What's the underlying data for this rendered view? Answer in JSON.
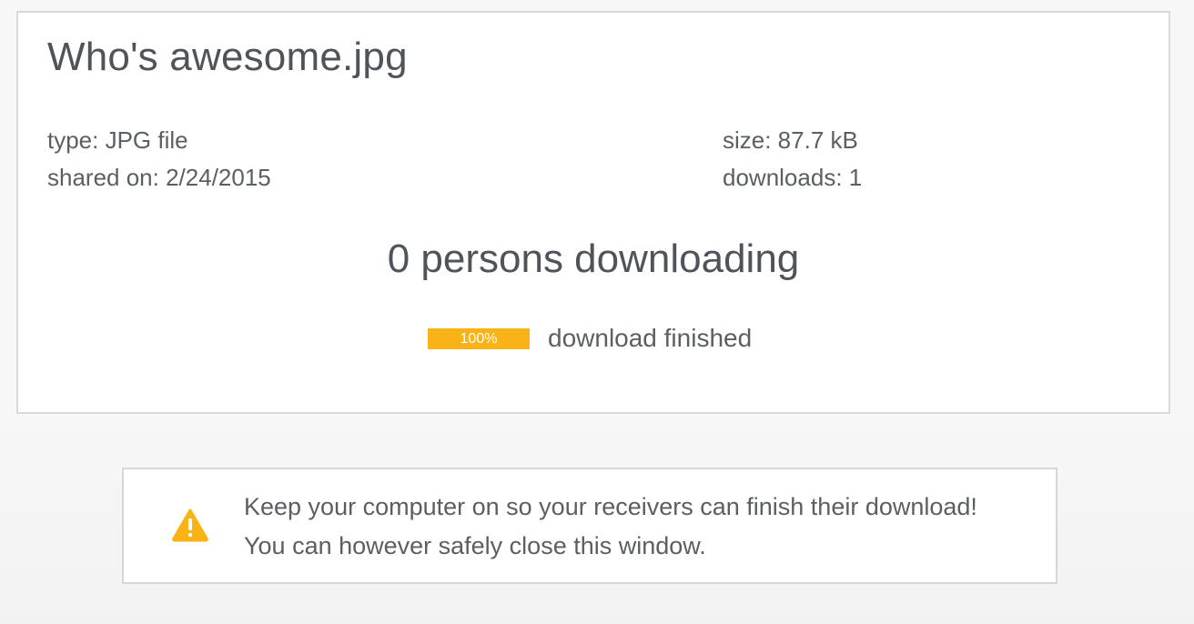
{
  "file": {
    "name": "Who's awesome.jpg",
    "type_text": "type: JPG file",
    "shared_text": "shared on: 2/24/2015",
    "size_text": "size: 87.7 kB",
    "downloads_text": "downloads: 1"
  },
  "status": {
    "persons_downloading": "0 persons downloading",
    "progress_percent": 100,
    "progress_label": "100%",
    "progress_text": "download finished"
  },
  "notice": {
    "icon": "warning-icon",
    "line1": "Keep your computer on so your receivers can finish their download!",
    "line2": "You can however safely close this window."
  },
  "colors": {
    "accent": "#f9b316",
    "text": "#4f545a",
    "border": "#d9d9d9"
  }
}
